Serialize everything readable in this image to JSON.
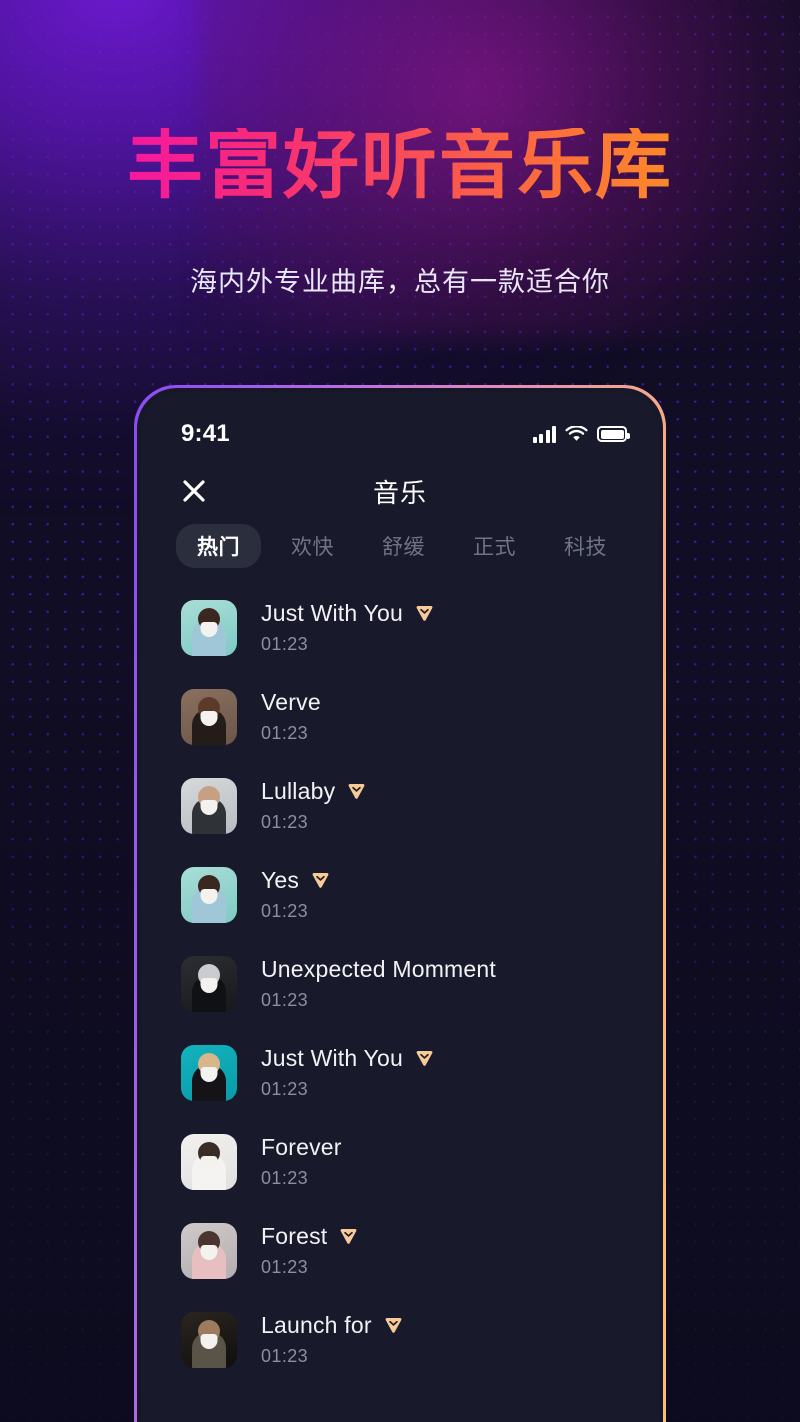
{
  "promo": {
    "headline": "丰富好听音乐库",
    "subheadline": "海内外专业曲库，总有一款适合你",
    "gradient_start": "#f61dbe",
    "gradient_end": "#ff9a17"
  },
  "phone": {
    "frame_gradient_start": "#8a4bf2",
    "frame_gradient_end": "#fcbd78",
    "screen_bg": "#181a2b"
  },
  "status_bar": {
    "time": "9:41",
    "signal_icon": "signal-bars-icon",
    "wifi_icon": "wifi-icon",
    "battery_icon": "battery-full-icon"
  },
  "navbar": {
    "close_icon": "close-icon",
    "title": "音乐"
  },
  "tabs": {
    "active_index": 0,
    "items": [
      {
        "label": "热门"
      },
      {
        "label": "欢快"
      },
      {
        "label": "舒缓"
      },
      {
        "label": "正式"
      },
      {
        "label": "科技"
      }
    ]
  },
  "tracklist": {
    "vip_badge_color": "#f7ca9b",
    "tracks": [
      {
        "title": "Just With You",
        "duration": "01:23",
        "vip": true,
        "art": {
          "bg": "#7fc9c4",
          "bg2": "#a8ded6",
          "body": "#9fc7d8",
          "head": "#3a2720"
        }
      },
      {
        "title": "Verve",
        "duration": "01:23",
        "vip": false,
        "art": {
          "bg": "#6b564a",
          "bg2": "#8a7060",
          "body": "#241c18",
          "head": "#5b3a2a"
        }
      },
      {
        "title": "Lullaby",
        "duration": "01:23",
        "vip": true,
        "art": {
          "bg": "#b8bcc0",
          "bg2": "#d7d9dc",
          "body": "#2f3338",
          "head": "#c79f82"
        }
      },
      {
        "title": "Yes",
        "duration": "01:23",
        "vip": true,
        "art": {
          "bg": "#7fc9c4",
          "bg2": "#a8ded6",
          "body": "#9fc7d8",
          "head": "#3a2720"
        }
      },
      {
        "title": "Unexpected Momment",
        "duration": "01:23",
        "vip": false,
        "art": {
          "bg": "#17181b",
          "bg2": "#2c2e33",
          "body": "#101114",
          "head": "#c9cdd2"
        }
      },
      {
        "title": "Just With You",
        "duration": "01:23",
        "vip": true,
        "art": {
          "bg": "#0a9aa8",
          "bg2": "#13b3bd",
          "body": "#151218",
          "head": "#d9b58c"
        }
      },
      {
        "title": "Forever",
        "duration": "01:23",
        "vip": false,
        "art": {
          "bg": "#e2e0de",
          "bg2": "#f2f1ef",
          "body": "#f4f3f1",
          "head": "#3a2d26"
        }
      },
      {
        "title": "Forest",
        "duration": "01:23",
        "vip": true,
        "art": {
          "bg": "#b4aeb0",
          "bg2": "#cfc9ca",
          "body": "#e8bfc0",
          "head": "#4a3530"
        }
      },
      {
        "title": "Launch for",
        "duration": "01:23",
        "vip": true,
        "art": {
          "bg": "#100e0d",
          "bg2": "#2a251f",
          "body": "#5a5347",
          "head": "#9d7b5e"
        }
      }
    ]
  }
}
